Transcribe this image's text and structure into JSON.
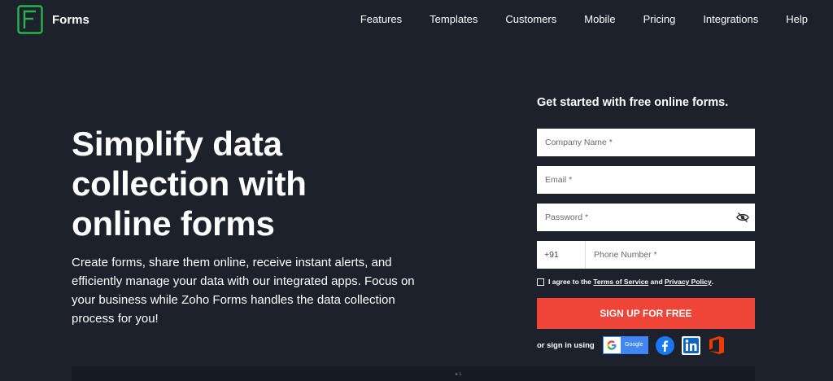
{
  "brand": {
    "name": "Forms",
    "color": "#2bb34b"
  },
  "nav": {
    "items": [
      "Features",
      "Templates",
      "Customers",
      "Mobile",
      "Pricing",
      "Integrations",
      "Help"
    ]
  },
  "hero": {
    "title": "Simplify data collection with online forms",
    "description": "Create forms, share them online, receive instant alerts, and efficiently manage your data with our integrated apps. Focus on your business while Zoho Forms handles the data collection process for you!"
  },
  "signup": {
    "heading": "Get started with free online forms.",
    "company_placeholder": "Company Name *",
    "email_placeholder": "Email *",
    "password_placeholder": "Password *",
    "phone_code": "+91",
    "phone_placeholder": "Phone Number *",
    "agree_prefix": "I agree to the",
    "terms_label": "Terms of Service",
    "agree_and": "and",
    "privacy_label": "Privacy Policy",
    "agree_suffix": ".",
    "button_label": "SIGN UP FOR FREE",
    "button_color": "#ef4538",
    "signin_label": "or sign in using",
    "google_label": "Google",
    "social_icons": [
      "google-icon",
      "facebook-icon",
      "linkedin-icon",
      "office-icon"
    ]
  },
  "footer_mark": "▸ L",
  "theme": {
    "background": "#1c212c"
  }
}
